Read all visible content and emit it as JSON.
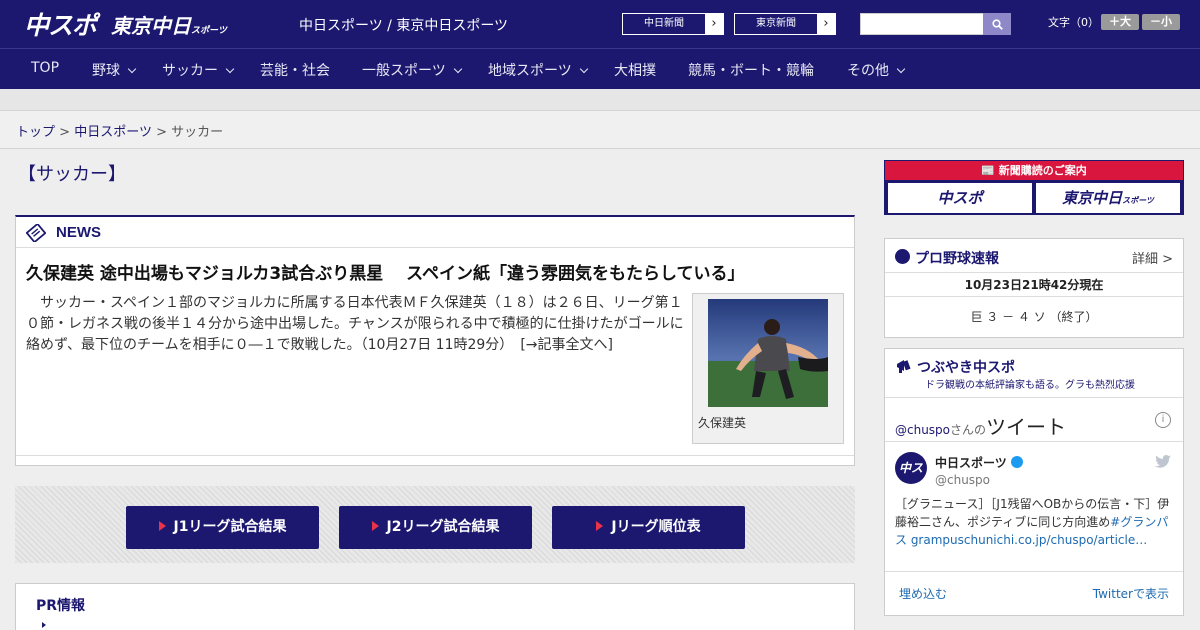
{
  "header": {
    "logo_chuspo": "中スポ",
    "logo_tokyo": "東京中日",
    "logo_tokyo_small": "スポーツ",
    "site_label": "中日スポーツ / 東京中日スポーツ",
    "ext_links": [
      "中日新聞",
      "東京新聞"
    ],
    "search_placeholder": "",
    "font_label": "文字（0）",
    "font_up": "＋大",
    "font_down": "－小"
  },
  "nav": {
    "items": [
      {
        "label": "TOP",
        "has_menu": false
      },
      {
        "label": "野球",
        "has_menu": true
      },
      {
        "label": "サッカー",
        "has_menu": true
      },
      {
        "label": "芸能・社会",
        "has_menu": false
      },
      {
        "label": "一般スポーツ",
        "has_menu": true
      },
      {
        "label": "地域スポーツ",
        "has_menu": true
      },
      {
        "label": "大相撲",
        "has_menu": false
      },
      {
        "label": "競馬・ボート・競輪",
        "has_menu": false
      },
      {
        "label": "その他",
        "has_menu": true
      }
    ]
  },
  "breadcrumb": {
    "home": "トップ",
    "sep": ">",
    "section": "中日スポーツ",
    "current": "サッカー"
  },
  "page_title": "【サッカー】",
  "news": {
    "label": "NEWS",
    "headline": "久保建英 途中出場もマジョルカ3試合ぶり黒星　 スペイン紙「違う雰囲気をもたらしている」",
    "body": "　サッカー・スペイン１部のマジョルカに所属する日本代表ＭＦ久保建英（１８）は２６日、リーグ第１０節・レガネス戦の後半１４分から途中出場した。チャンスが限られる中で積極的に仕掛けたがゴールに絡めず、最下位のチームを相手に０―１で敗戦した。（10月27日 11時29分）",
    "more_link": "[→記事全文へ]",
    "photo_caption": "久保建英"
  },
  "league_buttons": [
    "J1リーグ試合結果",
    "J2リーグ試合結果",
    "Jリーグ順位表"
  ],
  "pr": {
    "title": "PR情報"
  },
  "sidebar": {
    "subscribe": {
      "title": "新聞購読のご案内",
      "left": "中スポ",
      "right": "東京中日",
      "right_small": "スポーツ"
    },
    "baseball": {
      "title": "プロ野球速報",
      "more": "詳細 >",
      "time": "10月23日21時42分現在",
      "score": "巨 ３ － ４ ソ （終了）"
    },
    "tweet": {
      "title": "つぶやき中スポ",
      "subtitle": "ドラ観戦の本紙評論家も語る。グラも熱烈応援",
      "user": "@chuspo",
      "user_suffix": "さんの",
      "word": "ツイート",
      "info": "i",
      "avatar": "中スポ",
      "name": "中日スポーツ",
      "handle": "@chuspo",
      "text_1": "［グラニュース］［J1残留へOBからの伝言・下］伊藤裕二さん、ポジティブに同じ方向進め",
      "text_link": "#グランパス grampuschunichi.co.jp/chuspo/article…",
      "embed": "埋め込む",
      "view": "Twitterで表示"
    }
  },
  "colors": {
    "navy": "#1c1870",
    "accent_red": "#e8334a",
    "subscribe_red": "#d8163e",
    "twitter_blue": "#1d9bf0"
  }
}
